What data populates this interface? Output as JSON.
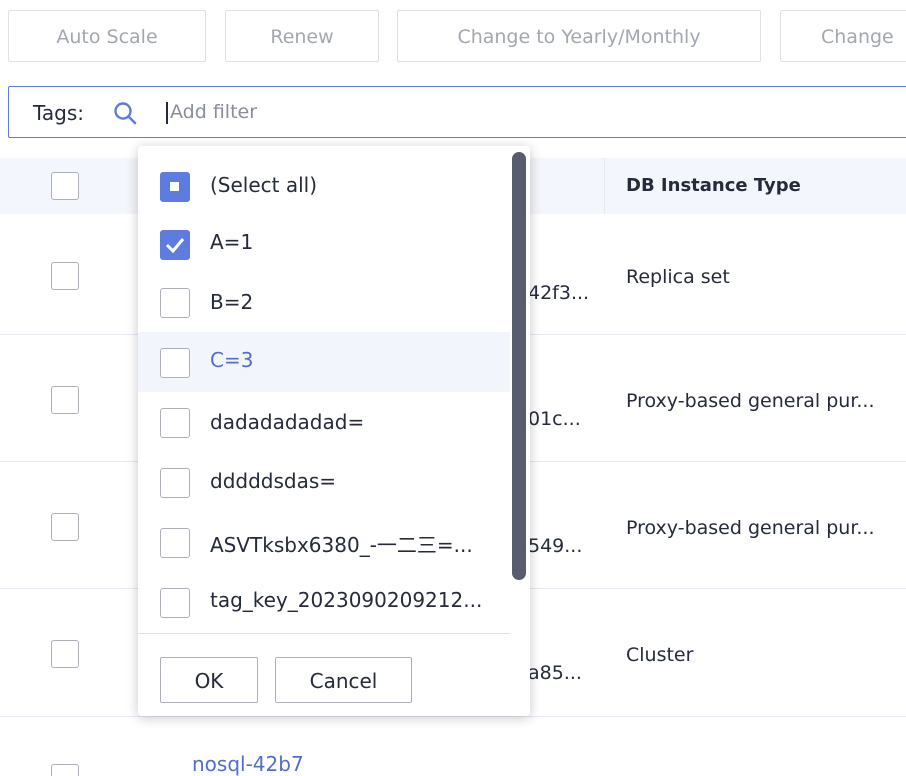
{
  "toolbar": {
    "auto_scale": "Auto Scale",
    "renew": "Renew",
    "change_yearly": "Change to Yearly/Monthly",
    "change": "Change"
  },
  "search": {
    "label": "Tags:",
    "placeholder": "Add filter",
    "icon": "search-icon"
  },
  "table": {
    "column_header": "DB Instance Type",
    "rows": [
      {
        "id_fragment": "42f3...",
        "type": "Replica set"
      },
      {
        "id_fragment": "01c...",
        "type": "Proxy-based general pur..."
      },
      {
        "id_fragment": "549...",
        "type": "Proxy-based general pur..."
      },
      {
        "id_fragment": "a85...",
        "type": "Cluster"
      },
      {
        "name": "nosql-42b7"
      }
    ]
  },
  "dropdown": {
    "items": [
      {
        "label": "(Select all)",
        "state": "partial"
      },
      {
        "label": "A=1",
        "state": "checked"
      },
      {
        "label": "B=2",
        "state": "unchecked"
      },
      {
        "label": "C=3",
        "state": "unchecked"
      },
      {
        "label": "dadadadadad=",
        "state": "unchecked"
      },
      {
        "label": "dddddsdas=",
        "state": "unchecked"
      },
      {
        "label": "ASVTksbx6380_-一二三=...",
        "state": "unchecked"
      },
      {
        "label": "tag_key_2023090209212...",
        "state": "unchecked"
      }
    ],
    "ok": "OK",
    "cancel": "Cancel"
  },
  "colors": {
    "accent": "#5e7ce0",
    "link": "#526ecc",
    "header_bg": "#f3f6fc"
  }
}
